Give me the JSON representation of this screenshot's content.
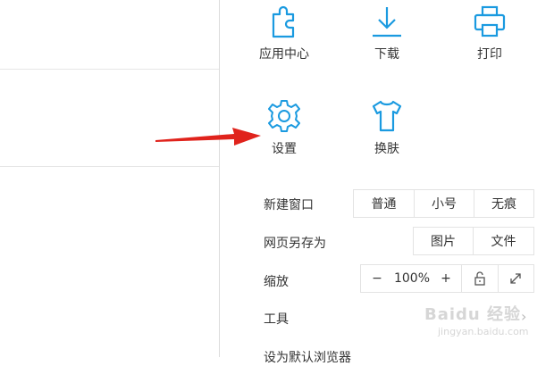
{
  "menu": {
    "icons": [
      {
        "label": "应用中心",
        "icon": "puzzle-icon"
      },
      {
        "label": "下载",
        "icon": "download-icon"
      },
      {
        "label": "打印",
        "icon": "printer-icon"
      },
      {
        "label": "设置",
        "icon": "gear-icon"
      },
      {
        "label": "换肤",
        "icon": "tshirt-icon"
      }
    ],
    "new_window": {
      "label": "新建窗口",
      "options": [
        "普通",
        "小号",
        "无痕"
      ]
    },
    "save_as": {
      "label": "网页另存为",
      "options": [
        "图片",
        "文件"
      ]
    },
    "zoom": {
      "label": "缩放",
      "minus": "−",
      "value": "100%",
      "plus": "+"
    },
    "tools": {
      "label": "工具"
    },
    "default_browser": {
      "label": "设为默认浏览器"
    }
  },
  "watermark": {
    "text": "Baidu 经验",
    "sub": "jingyan.baidu.com"
  },
  "colors": {
    "accent": "#1a9ae0",
    "arrow": "#e0231c"
  }
}
